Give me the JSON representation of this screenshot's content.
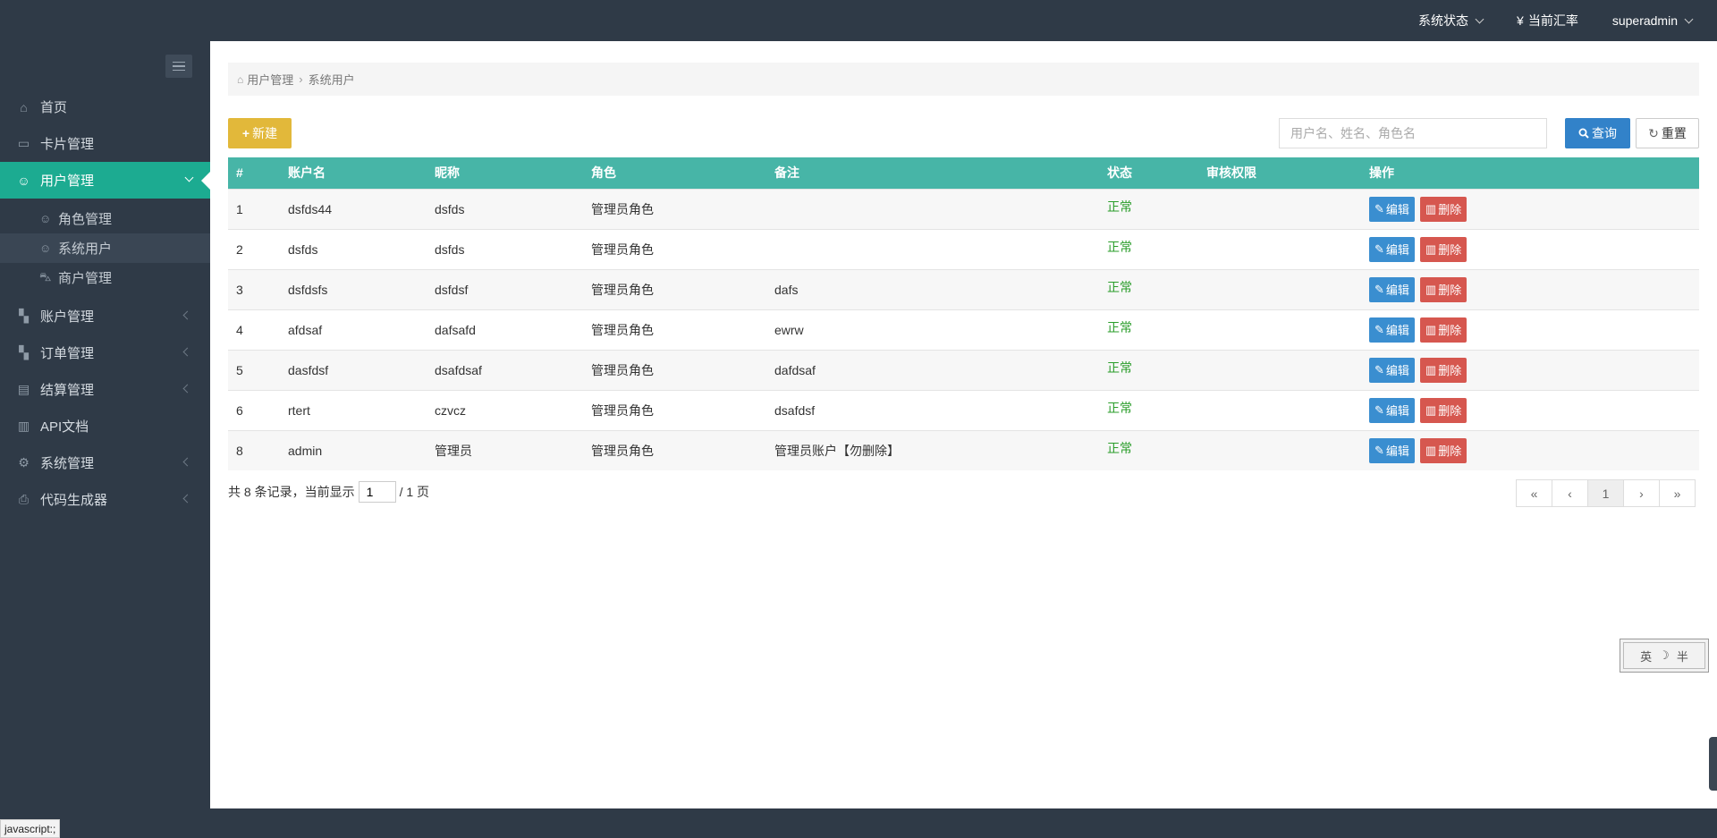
{
  "header": {
    "system_status": "系统状态",
    "currency_symbol": "¥",
    "exchange_rate": "当前汇率",
    "user": "superadmin"
  },
  "sidebar": {
    "items": [
      {
        "label": "首页",
        "icon": "home-icon"
      },
      {
        "label": "卡片管理",
        "icon": "card-icon"
      },
      {
        "label": "用户管理",
        "icon": "user-icon",
        "active": true,
        "children": [
          {
            "label": "角色管理",
            "icon": "user-outline-icon"
          },
          {
            "label": "系统用户",
            "icon": "user-outline-icon",
            "current": true
          },
          {
            "label": "商户管理",
            "icon": "car-icon"
          }
        ]
      },
      {
        "label": "账户管理",
        "icon": "grid-icon"
      },
      {
        "label": "订单管理",
        "icon": "grid-icon"
      },
      {
        "label": "结算管理",
        "icon": "file-icon"
      },
      {
        "label": "API文档",
        "icon": "book-icon"
      },
      {
        "label": "系统管理",
        "icon": "gear-icon"
      },
      {
        "label": "代码生成器",
        "icon": "printer-icon"
      }
    ]
  },
  "breadcrumb": {
    "parent": "用户管理",
    "current": "系统用户"
  },
  "toolbar": {
    "new_label": "新建",
    "search_placeholder": "用户名、姓名、角色名",
    "search_label": "查询",
    "reset_label": "重置"
  },
  "table": {
    "headers": [
      "#",
      "账户名",
      "昵称",
      "角色",
      "备注",
      "状态",
      "审核权限",
      "操作"
    ],
    "edit_label": "编辑",
    "delete_label": "删除",
    "rows": [
      {
        "id": "1",
        "account": "dsfds44",
        "nickname": "dsfds",
        "role": "管理员角色",
        "remark": "",
        "status": "正常",
        "audit": ""
      },
      {
        "id": "2",
        "account": "dsfds",
        "nickname": "dsfds",
        "role": "管理员角色",
        "remark": "",
        "status": "正常",
        "audit": ""
      },
      {
        "id": "3",
        "account": "dsfdsfs",
        "nickname": "dsfdsf",
        "role": "管理员角色",
        "remark": "dafs",
        "status": "正常",
        "audit": ""
      },
      {
        "id": "4",
        "account": "afdsaf",
        "nickname": "dafsafd",
        "role": "管理员角色",
        "remark": "ewrw",
        "status": "正常",
        "audit": ""
      },
      {
        "id": "5",
        "account": "dasfdsf",
        "nickname": "dsafdsaf",
        "role": "管理员角色",
        "remark": "dafdsaf",
        "status": "正常",
        "audit": ""
      },
      {
        "id": "6",
        "account": "rtert",
        "nickname": "czvcz",
        "role": "管理员角色",
        "remark": "dsafdsf",
        "status": "正常",
        "audit": ""
      },
      {
        "id": "8",
        "account": "admin",
        "nickname": "管理员",
        "role": "管理员角色",
        "remark": "管理员账户【勿删除】",
        "status": "正常",
        "audit": ""
      }
    ]
  },
  "pagination": {
    "summary_prefix": "共 8 条记录，当前显示",
    "current_page": "1",
    "summary_suffix": "/ 1 页",
    "first": "«",
    "prev": "‹",
    "page": "1",
    "next": "›",
    "last": "»"
  },
  "ime": {
    "lang": "英",
    "moon": "☽",
    "width": "半"
  },
  "status_url": "javascript:;",
  "colors": {
    "accent": "#1cab91",
    "table_header": "#47b5a7",
    "primary": "#3282c9",
    "warning": "#e2b83a",
    "danger": "#d6574f",
    "dark_bg": "#2f3a47",
    "status_ok": "#2a9d2a"
  }
}
